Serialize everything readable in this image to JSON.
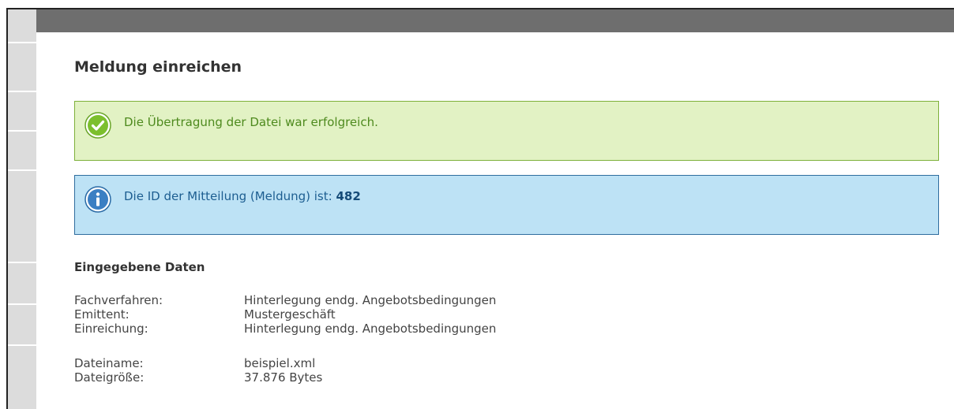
{
  "page": {
    "title": "Meldung einreichen"
  },
  "messages": {
    "success": {
      "text": "Die Übertragung der Datei war erfolgreich.",
      "icon": "check-circle-icon",
      "color": "#7eb03a"
    },
    "info": {
      "text_prefix": "Die ID der Mitteilung (Meldung) ist:",
      "id_value": "482",
      "icon": "info-circle-icon",
      "color": "#2f6d9e"
    }
  },
  "details": {
    "section_title": "Eingegebene Daten",
    "group1": [
      {
        "label": "Fachverfahren:",
        "value": "Hinterlegung endg. Angebotsbedingungen"
      },
      {
        "label": "Emittent:",
        "value": "Mustergeschäft"
      },
      {
        "label": "Einreichung:",
        "value": "Hinterlegung endg. Angebotsbedingungen"
      }
    ],
    "group2": [
      {
        "label": "Dateiname:",
        "value": "beispiel.xml"
      },
      {
        "label": "Dateigröße:",
        "value": "37.876 Bytes"
      }
    ]
  }
}
